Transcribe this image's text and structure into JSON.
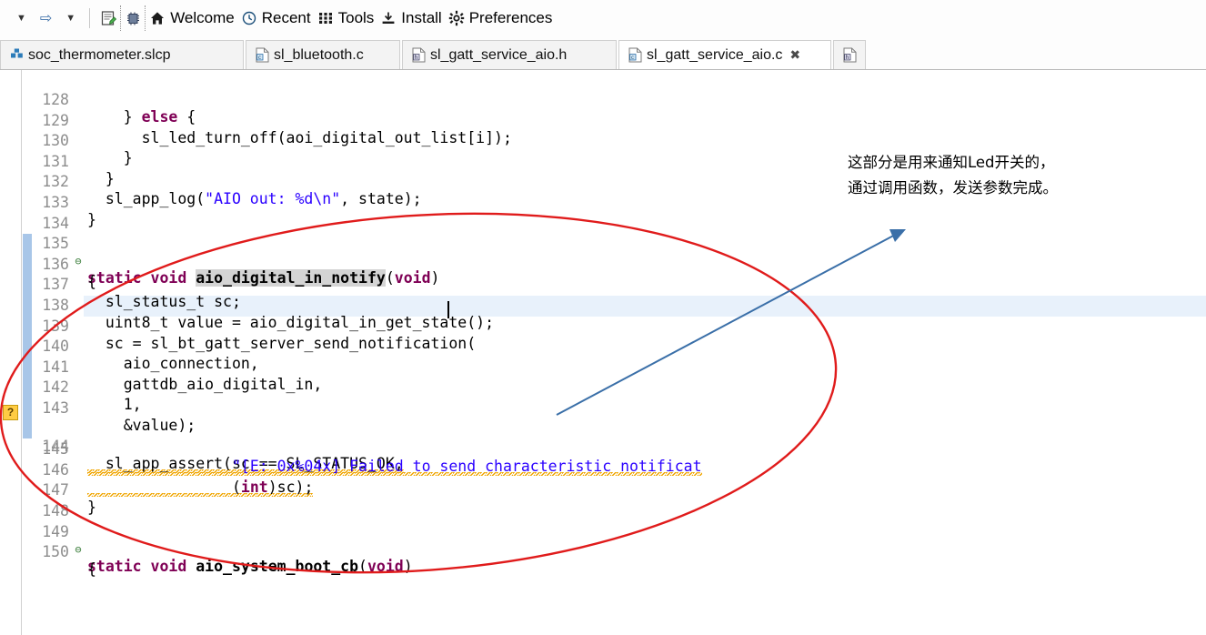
{
  "toolbar": {
    "items": [
      {
        "name": "back-dropdown",
        "icon": "caret-down-icon",
        "label": ""
      },
      {
        "name": "forward-arrow",
        "icon": "right-arrow-icon",
        "label": ""
      },
      {
        "name": "forward-dropdown",
        "icon": "caret-down-icon",
        "label": ""
      },
      {
        "name": "new-file-button",
        "icon": "new-file-icon",
        "label": ""
      },
      {
        "name": "debug-device-button",
        "icon": "chip-icon",
        "label": ""
      },
      {
        "name": "welcome-button",
        "icon": "home-icon",
        "label": "Welcome"
      },
      {
        "name": "recent-button",
        "icon": "clock-icon",
        "label": "Recent"
      },
      {
        "name": "tools-button",
        "icon": "grid-icon",
        "label": "Tools"
      },
      {
        "name": "install-button",
        "icon": "install-icon",
        "label": "Install"
      },
      {
        "name": "preferences-button",
        "icon": "gear-icon",
        "label": "Preferences"
      }
    ]
  },
  "tabs": [
    {
      "label": "soc_thermometer.slcp",
      "icon": "slcp-icon",
      "active": false,
      "closable": false
    },
    {
      "label": "sl_bluetooth.c",
      "icon": "c-file-icon",
      "active": false,
      "closable": false
    },
    {
      "label": "sl_gatt_service_aio.h",
      "icon": "h-file-icon",
      "active": false,
      "closable": false
    },
    {
      "label": "sl_gatt_service_aio.c",
      "icon": "c-file-icon",
      "active": true,
      "closable": true
    },
    {
      "label": "",
      "icon": "h-file-icon",
      "active": false,
      "closable": false
    }
  ],
  "editor": {
    "file": "sl_gatt_service_aio.c",
    "cursor_line": 139,
    "warning_line": 144,
    "warning_tooltip": "?",
    "first_line_number": 128,
    "lines": [
      {
        "num": 128,
        "text": "    } else {"
      },
      {
        "num": 129,
        "text": "      sl_led_turn_off(aoi_digital_out_list[i]);"
      },
      {
        "num": 130,
        "text": "    }"
      },
      {
        "num": 131,
        "text": "  }"
      },
      {
        "num": 132,
        "text": "  sl_app_log(\"AIO out: %d\\n\", state);"
      },
      {
        "num": 133,
        "text": "}"
      },
      {
        "num": 134,
        "text": ""
      },
      {
        "num": 135,
        "text": "static void aio_digital_in_notify(void)",
        "fold": true
      },
      {
        "num": 136,
        "text": "{"
      },
      {
        "num": 137,
        "text": "  sl_status_t sc;"
      },
      {
        "num": 138,
        "text": "  uint8_t value = aio_digital_in_get_state();"
      },
      {
        "num": 139,
        "text": "  sc = sl_bt_gatt_server_send_notification("
      },
      {
        "num": 140,
        "text": "    aio_connection,"
      },
      {
        "num": 141,
        "text": "    gattdb_aio_digital_in,"
      },
      {
        "num": 142,
        "text": "    1,"
      },
      {
        "num": 143,
        "text": "    &value);"
      },
      {
        "num": 144,
        "text": "  sl_app_assert(sc == SL_STATUS_OK,"
      },
      {
        "num": 145,
        "text": "                \"[E: 0x%04x] Failed to send characteristic notificat"
      },
      {
        "num": 146,
        "text": "                (int)sc);"
      },
      {
        "num": 147,
        "text": "}"
      },
      {
        "num": 148,
        "text": ""
      },
      {
        "num": 149,
        "text": "static void aio_system_boot_cb(void)",
        "fold": true
      },
      {
        "num": 150,
        "text": "{"
      }
    ]
  },
  "annotations": {
    "note_line1": "这部分是用来通知Led开关的，",
    "note_line2": "通过调用函数，发送参数完成。",
    "ellipse_color": "#e01b1b",
    "arrow_color": "#3a6fa8",
    "note_color": "#000000"
  }
}
